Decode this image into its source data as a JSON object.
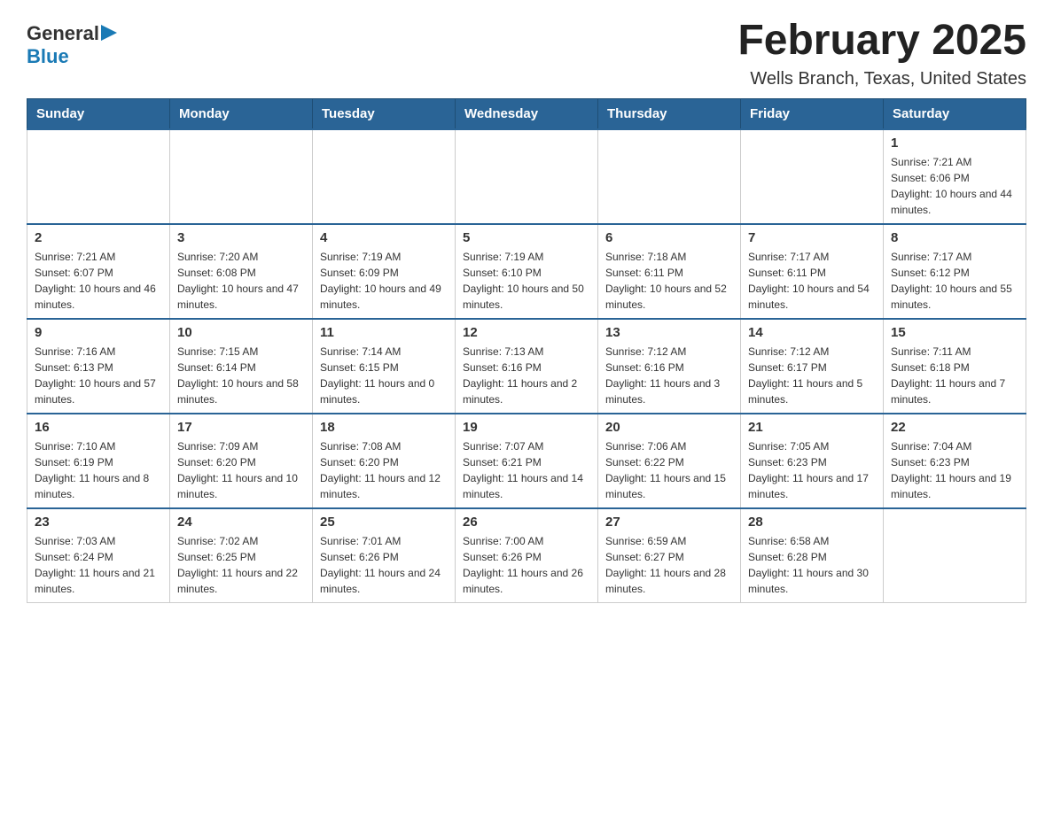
{
  "header": {
    "logo": {
      "general": "General",
      "blue": "Blue",
      "triangle": "▶"
    },
    "title": "February 2025",
    "subtitle": "Wells Branch, Texas, United States"
  },
  "weekdays": [
    "Sunday",
    "Monday",
    "Tuesday",
    "Wednesday",
    "Thursday",
    "Friday",
    "Saturday"
  ],
  "weeks": [
    [
      {
        "day": "",
        "sunrise": "",
        "sunset": "",
        "daylight": ""
      },
      {
        "day": "",
        "sunrise": "",
        "sunset": "",
        "daylight": ""
      },
      {
        "day": "",
        "sunrise": "",
        "sunset": "",
        "daylight": ""
      },
      {
        "day": "",
        "sunrise": "",
        "sunset": "",
        "daylight": ""
      },
      {
        "day": "",
        "sunrise": "",
        "sunset": "",
        "daylight": ""
      },
      {
        "day": "",
        "sunrise": "",
        "sunset": "",
        "daylight": ""
      },
      {
        "day": "1",
        "sunrise": "Sunrise: 7:21 AM",
        "sunset": "Sunset: 6:06 PM",
        "daylight": "Daylight: 10 hours and 44 minutes."
      }
    ],
    [
      {
        "day": "2",
        "sunrise": "Sunrise: 7:21 AM",
        "sunset": "Sunset: 6:07 PM",
        "daylight": "Daylight: 10 hours and 46 minutes."
      },
      {
        "day": "3",
        "sunrise": "Sunrise: 7:20 AM",
        "sunset": "Sunset: 6:08 PM",
        "daylight": "Daylight: 10 hours and 47 minutes."
      },
      {
        "day": "4",
        "sunrise": "Sunrise: 7:19 AM",
        "sunset": "Sunset: 6:09 PM",
        "daylight": "Daylight: 10 hours and 49 minutes."
      },
      {
        "day": "5",
        "sunrise": "Sunrise: 7:19 AM",
        "sunset": "Sunset: 6:10 PM",
        "daylight": "Daylight: 10 hours and 50 minutes."
      },
      {
        "day": "6",
        "sunrise": "Sunrise: 7:18 AM",
        "sunset": "Sunset: 6:11 PM",
        "daylight": "Daylight: 10 hours and 52 minutes."
      },
      {
        "day": "7",
        "sunrise": "Sunrise: 7:17 AM",
        "sunset": "Sunset: 6:11 PM",
        "daylight": "Daylight: 10 hours and 54 minutes."
      },
      {
        "day": "8",
        "sunrise": "Sunrise: 7:17 AM",
        "sunset": "Sunset: 6:12 PM",
        "daylight": "Daylight: 10 hours and 55 minutes."
      }
    ],
    [
      {
        "day": "9",
        "sunrise": "Sunrise: 7:16 AM",
        "sunset": "Sunset: 6:13 PM",
        "daylight": "Daylight: 10 hours and 57 minutes."
      },
      {
        "day": "10",
        "sunrise": "Sunrise: 7:15 AM",
        "sunset": "Sunset: 6:14 PM",
        "daylight": "Daylight: 10 hours and 58 minutes."
      },
      {
        "day": "11",
        "sunrise": "Sunrise: 7:14 AM",
        "sunset": "Sunset: 6:15 PM",
        "daylight": "Daylight: 11 hours and 0 minutes."
      },
      {
        "day": "12",
        "sunrise": "Sunrise: 7:13 AM",
        "sunset": "Sunset: 6:16 PM",
        "daylight": "Daylight: 11 hours and 2 minutes."
      },
      {
        "day": "13",
        "sunrise": "Sunrise: 7:12 AM",
        "sunset": "Sunset: 6:16 PM",
        "daylight": "Daylight: 11 hours and 3 minutes."
      },
      {
        "day": "14",
        "sunrise": "Sunrise: 7:12 AM",
        "sunset": "Sunset: 6:17 PM",
        "daylight": "Daylight: 11 hours and 5 minutes."
      },
      {
        "day": "15",
        "sunrise": "Sunrise: 7:11 AM",
        "sunset": "Sunset: 6:18 PM",
        "daylight": "Daylight: 11 hours and 7 minutes."
      }
    ],
    [
      {
        "day": "16",
        "sunrise": "Sunrise: 7:10 AM",
        "sunset": "Sunset: 6:19 PM",
        "daylight": "Daylight: 11 hours and 8 minutes."
      },
      {
        "day": "17",
        "sunrise": "Sunrise: 7:09 AM",
        "sunset": "Sunset: 6:20 PM",
        "daylight": "Daylight: 11 hours and 10 minutes."
      },
      {
        "day": "18",
        "sunrise": "Sunrise: 7:08 AM",
        "sunset": "Sunset: 6:20 PM",
        "daylight": "Daylight: 11 hours and 12 minutes."
      },
      {
        "day": "19",
        "sunrise": "Sunrise: 7:07 AM",
        "sunset": "Sunset: 6:21 PM",
        "daylight": "Daylight: 11 hours and 14 minutes."
      },
      {
        "day": "20",
        "sunrise": "Sunrise: 7:06 AM",
        "sunset": "Sunset: 6:22 PM",
        "daylight": "Daylight: 11 hours and 15 minutes."
      },
      {
        "day": "21",
        "sunrise": "Sunrise: 7:05 AM",
        "sunset": "Sunset: 6:23 PM",
        "daylight": "Daylight: 11 hours and 17 minutes."
      },
      {
        "day": "22",
        "sunrise": "Sunrise: 7:04 AM",
        "sunset": "Sunset: 6:23 PM",
        "daylight": "Daylight: 11 hours and 19 minutes."
      }
    ],
    [
      {
        "day": "23",
        "sunrise": "Sunrise: 7:03 AM",
        "sunset": "Sunset: 6:24 PM",
        "daylight": "Daylight: 11 hours and 21 minutes."
      },
      {
        "day": "24",
        "sunrise": "Sunrise: 7:02 AM",
        "sunset": "Sunset: 6:25 PM",
        "daylight": "Daylight: 11 hours and 22 minutes."
      },
      {
        "day": "25",
        "sunrise": "Sunrise: 7:01 AM",
        "sunset": "Sunset: 6:26 PM",
        "daylight": "Daylight: 11 hours and 24 minutes."
      },
      {
        "day": "26",
        "sunrise": "Sunrise: 7:00 AM",
        "sunset": "Sunset: 6:26 PM",
        "daylight": "Daylight: 11 hours and 26 minutes."
      },
      {
        "day": "27",
        "sunrise": "Sunrise: 6:59 AM",
        "sunset": "Sunset: 6:27 PM",
        "daylight": "Daylight: 11 hours and 28 minutes."
      },
      {
        "day": "28",
        "sunrise": "Sunrise: 6:58 AM",
        "sunset": "Sunset: 6:28 PM",
        "daylight": "Daylight: 11 hours and 30 minutes."
      },
      {
        "day": "",
        "sunrise": "",
        "sunset": "",
        "daylight": ""
      }
    ]
  ]
}
